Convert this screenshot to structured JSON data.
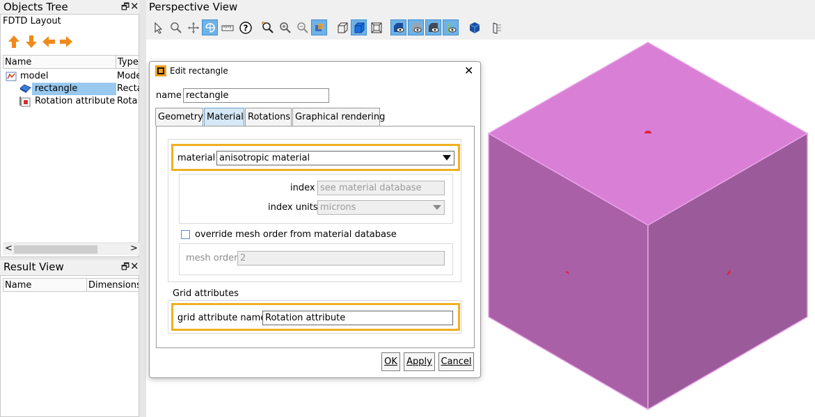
{
  "objects_tree": {
    "title": "Objects Tree",
    "layout_label": "FDTD Layout",
    "col_name": "Name",
    "col_type": "Type",
    "rows": [
      {
        "name": "model",
        "type": "Mode",
        "icon": "model-icon"
      },
      {
        "name": "rectangle",
        "type": "Recta",
        "icon": "rectangle-icon",
        "selected": true
      },
      {
        "name": "Rotation attribute",
        "type": "Rota",
        "icon": "rotation-attribute-icon"
      }
    ],
    "arrow_color": "#f08a1c"
  },
  "result_view": {
    "title": "Result View",
    "col_name": "Name",
    "col_dimensions": "Dimensions/"
  },
  "perspective": {
    "title": "Perspective View",
    "toolbar_icons": [
      "select-icon",
      "zoom-region-icon",
      "pan-icon",
      "rotate-icon",
      "ruler-icon",
      "help-icon",
      "zoom-extent-icon",
      "zoom-in-icon",
      "zoom-out-icon",
      "zoom-fit-icon",
      "wireframe-icon",
      "solid-icon",
      "perspective-box-icon",
      "view-object-icon",
      "view-mesh-icon",
      "view-slice-icon",
      "view-light-icon",
      "cube-view-icon",
      "layer-icon"
    ],
    "cube_top_color": "#d97fd6",
    "cube_left_color": "#a960a6",
    "cube_right_color": "#9b5b9a",
    "marker_color": "#e0203a"
  },
  "dialog": {
    "title": "Edit rectangle",
    "name_label": "name",
    "name_value": "rectangle",
    "tabs": [
      {
        "label": "Geometry",
        "active": false
      },
      {
        "label": "Material",
        "active": true
      },
      {
        "label": "Rotations",
        "active": false
      },
      {
        "label": "Graphical rendering",
        "active": false
      }
    ],
    "material_label": "material",
    "material_value": "anisotropic material",
    "index_label": "index",
    "index_placeholder": "see material database",
    "index_units_label": "index units",
    "index_units_value": "microns",
    "override_label": "override mesh order from material database",
    "override_checked": false,
    "mesh_order_label": "mesh order",
    "mesh_order_value": "2",
    "grid_attributes_label": "Grid attributes",
    "grid_attribute_name_label": "grid attribute name",
    "grid_attribute_name_value": "Rotation attribute",
    "ok_label": "OK",
    "apply_label": "Apply",
    "cancel_label": "Cancel",
    "highlight_color": "#f0b020"
  }
}
